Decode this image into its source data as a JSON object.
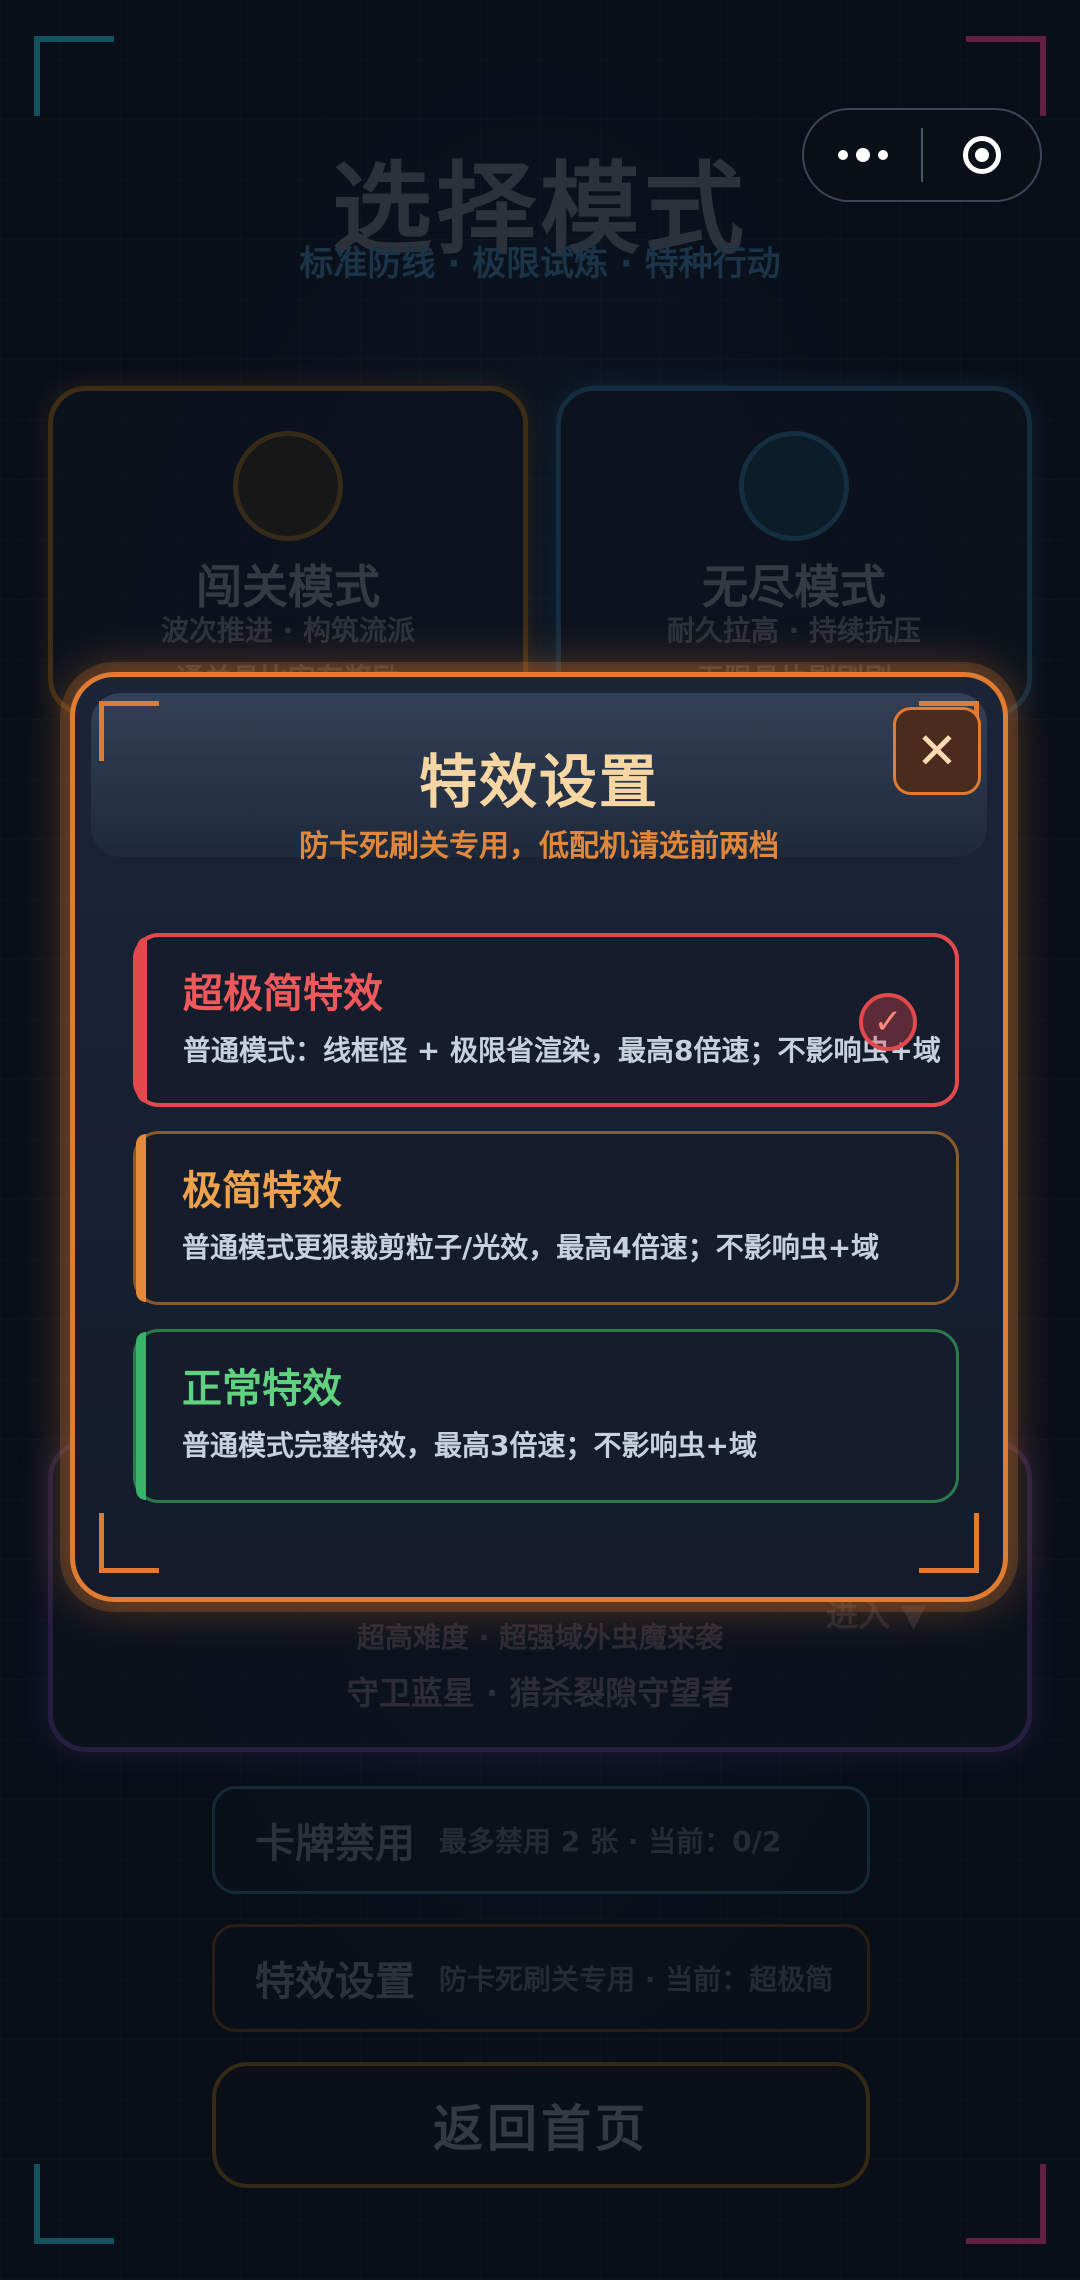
{
  "capsule": {
    "more_icon": "more-dots-icon",
    "close_icon": "target-circle-icon"
  },
  "background": {
    "title": "选择模式",
    "subtitle": "标准防线 · 极限试炼 · 特种行动",
    "cards": [
      {
        "title": "闯关模式",
        "sub1": "波次推进 · 构筑流派",
        "sub2": "通关具比安有奖励"
      },
      {
        "title": "无尽模式",
        "sub1": "耐久拉高 · 持续抗压",
        "sub2": "无限具片剔刷刷"
      }
    ],
    "bottom_card": {
      "sub1": "超高难度 · 超强域外虫魔来袭",
      "sub2": "守卫蓝星 · 猎杀裂隙守望者",
      "enter": "进入 ▼"
    },
    "card_ban": {
      "title": "卡牌禁用",
      "info": "最多禁用 2 张 · 当前：0/2"
    },
    "card_fx": {
      "title": "特效设置",
      "info": "防卡死刷关专用 · 当前：超极简"
    },
    "home_button": "返回首页"
  },
  "modal": {
    "title": "特效设置",
    "subtitle": "防卡死刷关专用，低配机请选前两档",
    "close_label": "✕",
    "options": [
      {
        "title": "超极简特效",
        "desc": "普通模式：线框怪 + 极限省渲染，最高8倍速；不影响虫+域",
        "selected": true,
        "accent": "#e2484c"
      },
      {
        "title": "极简特效",
        "desc": "普通模式更狠裁剪粒子/光效，最高4倍速；不影响虫+域",
        "selected": false,
        "accent": "#e08a3a"
      },
      {
        "title": "正常特效",
        "desc": "普通模式完整特效，最高3倍速；不影响虫+域",
        "selected": false,
        "accent": "#39b46a"
      }
    ],
    "check_mark": "✓"
  }
}
